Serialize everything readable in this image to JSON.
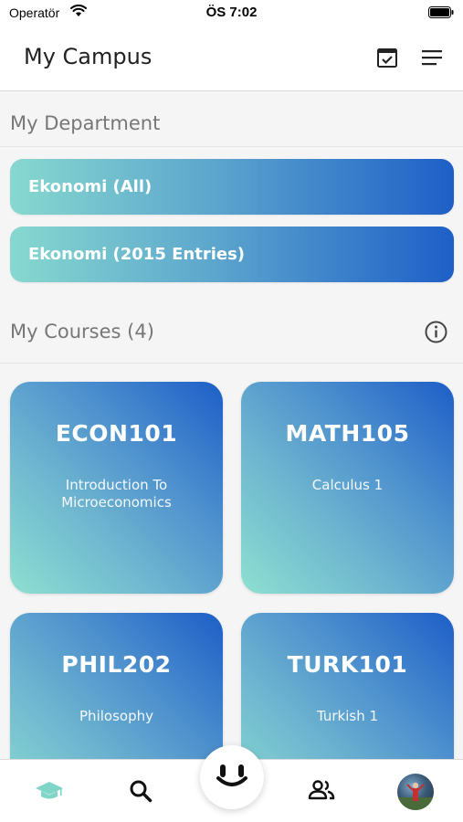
{
  "status_bar": {
    "carrier": "Operatör",
    "time": "ÖS 7:02"
  },
  "header": {
    "title": "My Campus",
    "icons": [
      "calendar-check-icon",
      "menu-icon"
    ]
  },
  "department": {
    "title": "My Department",
    "items": [
      {
        "label": "Ekonomi (All)"
      },
      {
        "label": "Ekonomi (2015 Entries)"
      }
    ]
  },
  "courses": {
    "title": "My Courses (4)",
    "items": [
      {
        "code": "ECON101",
        "name": "Introduction To Microeconomics"
      },
      {
        "code": "MATH105",
        "name": "Calculus 1"
      },
      {
        "code": "PHIL202",
        "name": "Philosophy"
      },
      {
        "code": "TURK101",
        "name": "Turkish 1"
      }
    ]
  },
  "tab_bar": {
    "tabs": [
      "graduation-cap-icon",
      "search-icon",
      "chat-face-icon",
      "people-icon",
      "avatar"
    ],
    "active_color": "#7fd6c8"
  },
  "colors": {
    "gradient_start": "#87d8cf",
    "gradient_end": "#1e5fc7"
  }
}
